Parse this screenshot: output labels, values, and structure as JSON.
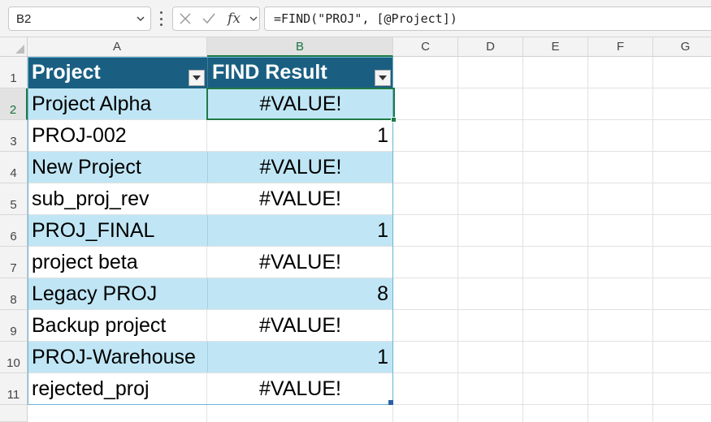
{
  "formula_bar": {
    "name_box": "B2",
    "fx_label": "fx",
    "formula": "=FIND(\"PROJ\", [@Project])"
  },
  "columns": [
    "A",
    "B",
    "C",
    "D",
    "E",
    "F",
    "G"
  ],
  "rows": [
    "1",
    "2",
    "3",
    "4",
    "5",
    "6",
    "7",
    "8",
    "9",
    "10",
    "11"
  ],
  "table": {
    "headers": [
      "Project",
      "FIND Result"
    ],
    "rows": [
      {
        "project": "Project Alpha",
        "result": "#VALUE!"
      },
      {
        "project": "PROJ-002",
        "result": "1"
      },
      {
        "project": "New Project",
        "result": "#VALUE!"
      },
      {
        "project": "sub_proj_rev",
        "result": "#VALUE!"
      },
      {
        "project": "PROJ_FINAL",
        "result": "1"
      },
      {
        "project": "project beta",
        "result": "#VALUE!"
      },
      {
        "project": "Legacy PROJ",
        "result": "8"
      },
      {
        "project": "Backup project",
        "result": "#VALUE!"
      },
      {
        "project": "PROJ-Warehouse",
        "result": "1"
      },
      {
        "project": "rejected_proj",
        "result": "#VALUE!"
      }
    ]
  },
  "colors": {
    "table_header": "#1a5f82",
    "band": "#c0e6f5",
    "selection": "#1f7a45"
  },
  "icons": [
    "chevron-down-icon",
    "more-vertical-icon",
    "cancel-icon",
    "check-icon",
    "insert-function-icon",
    "filter-dropdown-icon"
  ]
}
